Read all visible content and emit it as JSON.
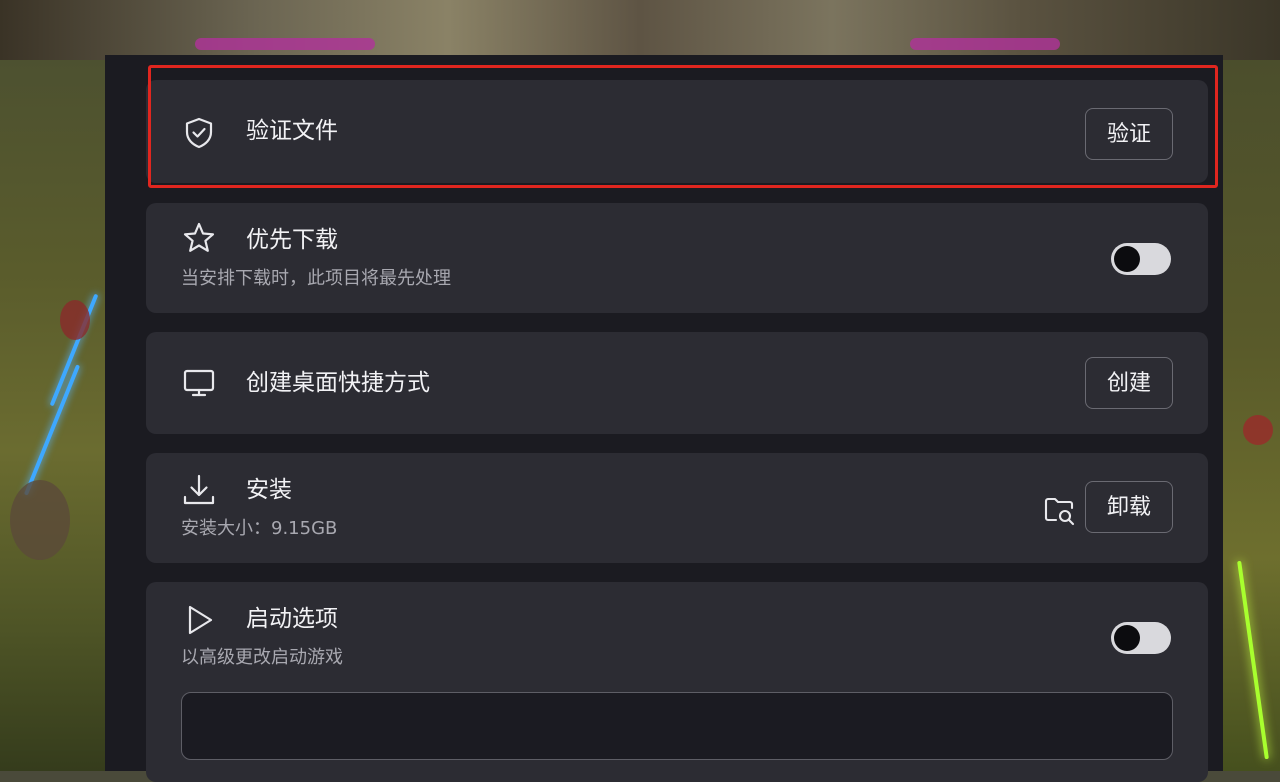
{
  "settings": {
    "verify": {
      "icon": "shield-check-icon",
      "title": "验证文件",
      "button_label": "验证"
    },
    "priority_download": {
      "icon": "star-icon",
      "title": "优先下载",
      "description": "当安排下载时，此项目将最先处理",
      "toggle_on": false
    },
    "desktop_shortcut": {
      "icon": "monitor-icon",
      "title": "创建桌面快捷方式",
      "button_label": "创建"
    },
    "install": {
      "icon": "download-icon",
      "title": "安装",
      "description": "安装大小：9.15GB",
      "folder_icon": "folder-search-icon",
      "button_label": "卸载"
    },
    "launch_options": {
      "icon": "play-icon",
      "title": "启动选项",
      "description": "以高级更改启动游戏",
      "toggle_on": false,
      "input_value": ""
    }
  },
  "colors": {
    "panel_bg": "#1b1b21",
    "card_bg": "#2c2c33",
    "highlight_border": "#e0261f",
    "toggle_track": "#d9d9dd"
  }
}
